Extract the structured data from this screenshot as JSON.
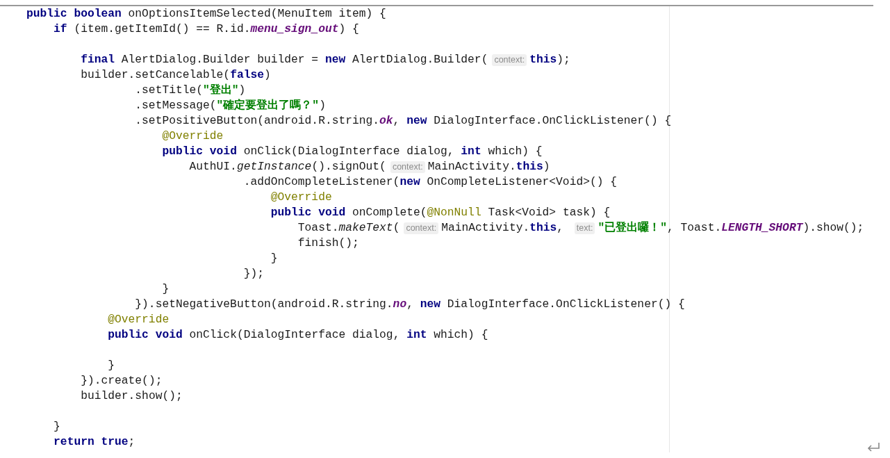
{
  "editor": {
    "lines": [
      {
        "kind": "code",
        "tokens": [
          {
            "kind": "keyword",
            "text": "public "
          },
          {
            "kind": "keyword",
            "text": "boolean"
          },
          {
            "kind": "plain",
            "text": " onOptionsItemSelected(MenuItem item) {"
          }
        ]
      },
      {
        "kind": "code",
        "tokens": [
          {
            "kind": "keyword",
            "text": "    if"
          },
          {
            "kind": "plain",
            "text": " (item.getItemId() == R.id."
          },
          {
            "kind": "field",
            "text": "menu_sign_out"
          },
          {
            "kind": "plain",
            "text": ") {"
          }
        ]
      },
      {
        "kind": "blank"
      },
      {
        "kind": "code",
        "tokens": [
          {
            "kind": "keyword",
            "text": "        final"
          },
          {
            "kind": "plain",
            "text": " AlertDialog.Builder builder = "
          },
          {
            "kind": "keyword",
            "text": "new"
          },
          {
            "kind": "plain",
            "text": " AlertDialog.Builder("
          },
          {
            "kind": "hint",
            "text": "context:"
          },
          {
            "kind": "keyword",
            "text": "this"
          },
          {
            "kind": "plain",
            "text": ");"
          }
        ]
      },
      {
        "kind": "code",
        "tokens": [
          {
            "kind": "plain",
            "text": "        builder.setCancelable("
          },
          {
            "kind": "keyword",
            "text": "false"
          },
          {
            "kind": "plain",
            "text": ")"
          }
        ]
      },
      {
        "kind": "code",
        "tokens": [
          {
            "kind": "plain",
            "text": "                .setTitle("
          },
          {
            "kind": "string",
            "text": "\"登出\""
          },
          {
            "kind": "plain",
            "text": ")"
          }
        ]
      },
      {
        "kind": "code",
        "tokens": [
          {
            "kind": "plain",
            "text": "                .setMessage("
          },
          {
            "kind": "string",
            "text": "\"確定要登出了嗎？\""
          },
          {
            "kind": "plain",
            "text": ")"
          }
        ]
      },
      {
        "kind": "code",
        "tokens": [
          {
            "kind": "plain",
            "text": "                .setPositiveButton(android.R.string."
          },
          {
            "kind": "field",
            "text": "ok"
          },
          {
            "kind": "plain",
            "text": ", "
          },
          {
            "kind": "keyword",
            "text": "new"
          },
          {
            "kind": "plain",
            "text": " DialogInterface.OnClickListener() {"
          }
        ]
      },
      {
        "kind": "code",
        "tokens": [
          {
            "kind": "annotation",
            "text": "                    @Override"
          }
        ]
      },
      {
        "kind": "code",
        "tokens": [
          {
            "kind": "keyword",
            "text": "                    public "
          },
          {
            "kind": "keyword",
            "text": "void"
          },
          {
            "kind": "plain",
            "text": " onClick(DialogInterface dialog, "
          },
          {
            "kind": "keyword",
            "text": "int"
          },
          {
            "kind": "plain",
            "text": " which) {"
          }
        ]
      },
      {
        "kind": "code",
        "tokens": [
          {
            "kind": "plain",
            "text": "                        AuthUI."
          },
          {
            "kind": "static",
            "text": "getInstance"
          },
          {
            "kind": "plain",
            "text": "().signOut("
          },
          {
            "kind": "hint",
            "text": "context:"
          },
          {
            "kind": "plain",
            "text": "MainActivity."
          },
          {
            "kind": "keyword",
            "text": "this"
          },
          {
            "kind": "plain",
            "text": ")"
          }
        ]
      },
      {
        "kind": "code",
        "tokens": [
          {
            "kind": "plain",
            "text": "                                .addOnCompleteListener("
          },
          {
            "kind": "keyword",
            "text": "new"
          },
          {
            "kind": "plain",
            "text": " OnCompleteListener<Void>() {"
          }
        ]
      },
      {
        "kind": "code",
        "tokens": [
          {
            "kind": "annotation",
            "text": "                                    @Override"
          }
        ]
      },
      {
        "kind": "code",
        "tokens": [
          {
            "kind": "keyword",
            "text": "                                    public "
          },
          {
            "kind": "keyword",
            "text": "void"
          },
          {
            "kind": "plain",
            "text": " onComplete("
          },
          {
            "kind": "annotation",
            "text": "@NonNull"
          },
          {
            "kind": "plain",
            "text": " Task<Void> task) {"
          }
        ]
      },
      {
        "kind": "code",
        "tokens": [
          {
            "kind": "plain",
            "text": "                                        Toast."
          },
          {
            "kind": "static",
            "text": "makeText"
          },
          {
            "kind": "plain",
            "text": "("
          },
          {
            "kind": "hint",
            "text": "context:"
          },
          {
            "kind": "plain",
            "text": "MainActivity."
          },
          {
            "kind": "keyword",
            "text": "this"
          },
          {
            "kind": "plain",
            "text": ", "
          },
          {
            "kind": "hint",
            "text": "text:"
          },
          {
            "kind": "string",
            "text": "\"已登出囉！\""
          },
          {
            "kind": "plain",
            "text": ", Toast."
          },
          {
            "kind": "field",
            "text": "LENGTH_SHORT"
          },
          {
            "kind": "plain",
            "text": ").show();"
          }
        ]
      },
      {
        "kind": "code",
        "tokens": [
          {
            "kind": "plain",
            "text": "                                        finish();"
          }
        ]
      },
      {
        "kind": "code",
        "tokens": [
          {
            "kind": "plain",
            "text": "                                    }"
          }
        ]
      },
      {
        "kind": "code",
        "tokens": [
          {
            "kind": "plain",
            "text": "                                });"
          }
        ]
      },
      {
        "kind": "code",
        "tokens": [
          {
            "kind": "plain",
            "text": "                    }"
          }
        ]
      },
      {
        "kind": "code",
        "tokens": [
          {
            "kind": "plain",
            "text": "                }).setNegativeButton(android.R.string."
          },
          {
            "kind": "field",
            "text": "no"
          },
          {
            "kind": "plain",
            "text": ", "
          },
          {
            "kind": "keyword",
            "text": "new"
          },
          {
            "kind": "plain",
            "text": " DialogInterface.OnClickListener() {"
          }
        ]
      },
      {
        "kind": "code",
        "tokens": [
          {
            "kind": "annotation",
            "text": "            @Override"
          }
        ]
      },
      {
        "kind": "code",
        "tokens": [
          {
            "kind": "keyword",
            "text": "            public "
          },
          {
            "kind": "keyword",
            "text": "void"
          },
          {
            "kind": "plain",
            "text": " onClick(DialogInterface dialog, "
          },
          {
            "kind": "keyword",
            "text": "int"
          },
          {
            "kind": "plain",
            "text": " which) {"
          }
        ]
      },
      {
        "kind": "blank"
      },
      {
        "kind": "code",
        "tokens": [
          {
            "kind": "plain",
            "text": "            }"
          }
        ]
      },
      {
        "kind": "code",
        "tokens": [
          {
            "kind": "plain",
            "text": "        }).create();"
          }
        ]
      },
      {
        "kind": "code",
        "tokens": [
          {
            "kind": "plain",
            "text": "        builder.show();"
          }
        ]
      },
      {
        "kind": "blank"
      },
      {
        "kind": "code",
        "tokens": [
          {
            "kind": "plain",
            "text": "    }"
          }
        ]
      },
      {
        "kind": "code",
        "tokens": [
          {
            "kind": "keyword",
            "text": "    return "
          },
          {
            "kind": "keyword",
            "text": "true"
          },
          {
            "kind": "plain",
            "text": ";"
          }
        ]
      }
    ]
  }
}
